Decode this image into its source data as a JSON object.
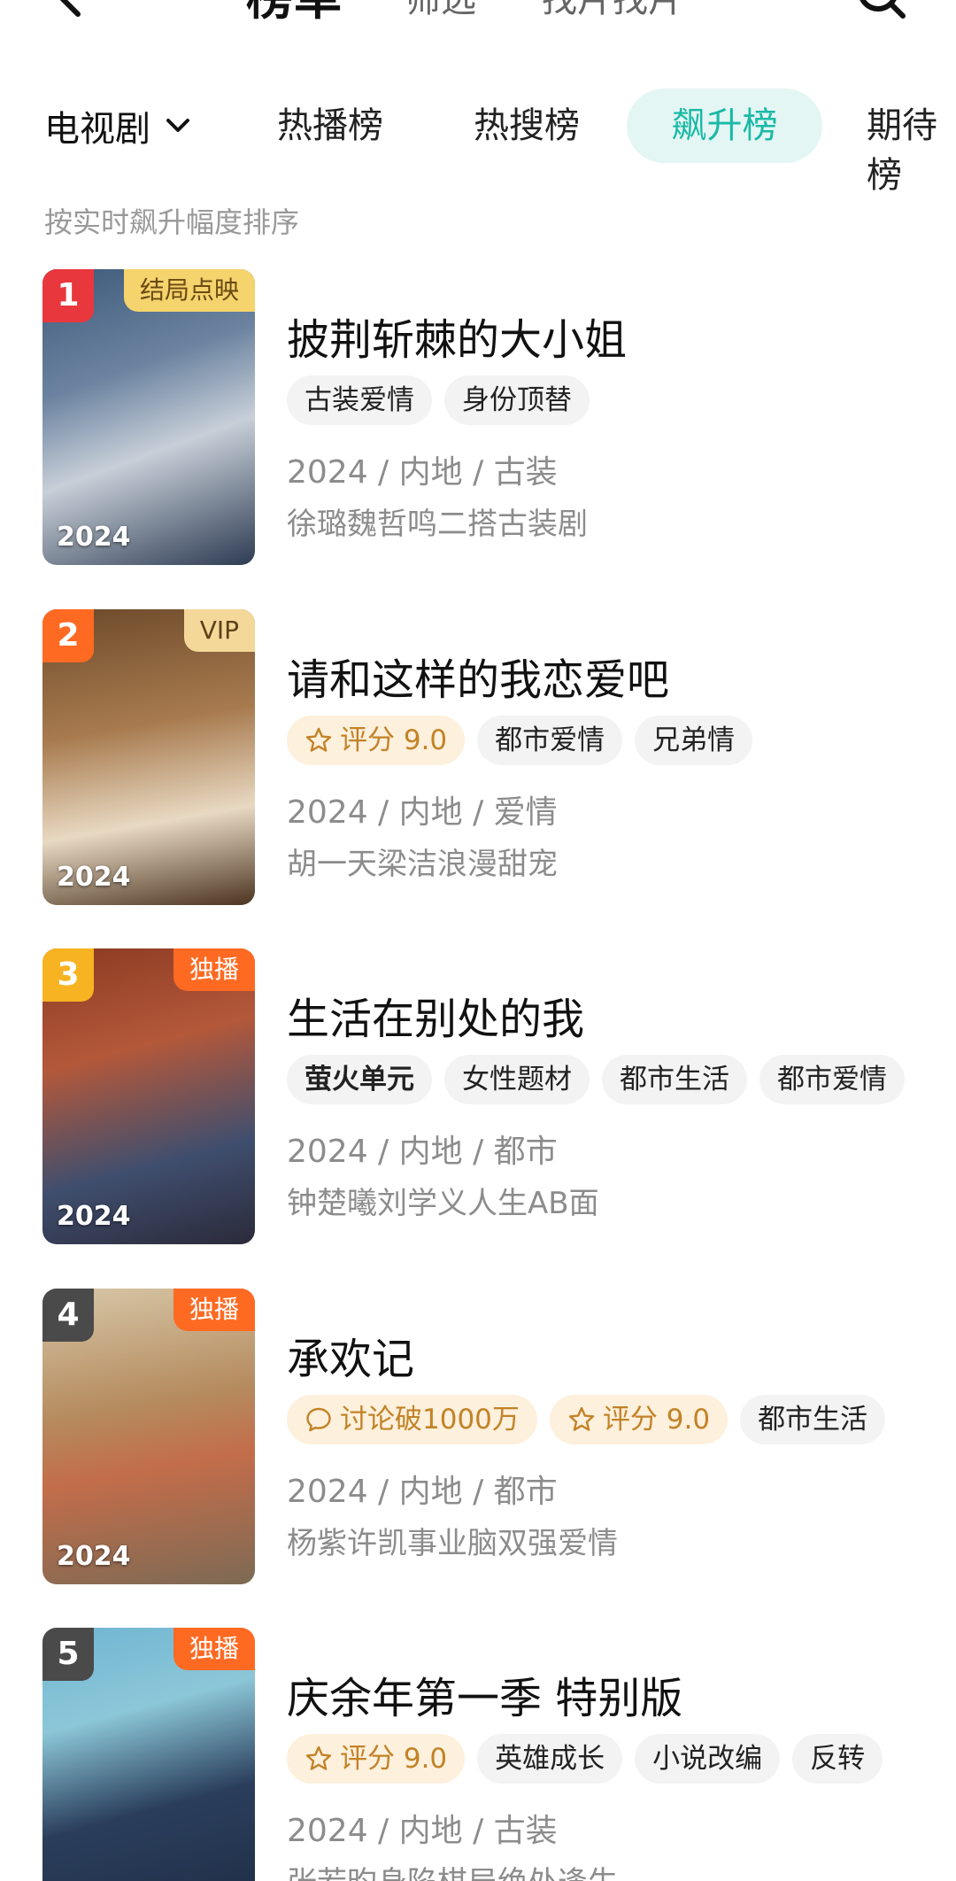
{
  "top_nav": {
    "title": "榜单",
    "tabs": [
      "筛选",
      "找片找片"
    ]
  },
  "categories": {
    "dropdown_label": "电视剧",
    "tabs": [
      "热播榜",
      "热搜榜",
      "飙升榜",
      "期待榜"
    ],
    "selected": "飙升榜"
  },
  "subtitle": "按实时飙升幅度排序",
  "colors": {
    "accent": "#19b9a6",
    "accent_bg": "#e3f6f4",
    "rank_red": "#e8383d",
    "rank_orange": "#ff6a23",
    "rank_yellow": "#f7b321",
    "rank_gray": "#4a4a4a"
  },
  "items": [
    {
      "rank": "1",
      "badge": "结局点映",
      "year_overlay": "2024",
      "title": "披荆斩棘的大小姐",
      "tags": [
        "古装爱情",
        "身份顶替"
      ],
      "meta": "2024 / 内地 / 古装",
      "desc": "徐璐魏哲鸣二搭古装剧"
    },
    {
      "rank": "2",
      "badge": "VIP",
      "year_overlay": "2024",
      "title": "请和这样的我恋爱吧",
      "score_tag": "评分 9.0",
      "tags": [
        "都市爱情",
        "兄弟情"
      ],
      "meta": "2024 / 内地 / 爱情",
      "desc": "胡一天梁洁浪漫甜宠"
    },
    {
      "rank": "3",
      "badge": "独播",
      "year_overlay": "2024",
      "title": "生活在别处的我",
      "brand_tag": "萤火单元",
      "tags": [
        "女性题材",
        "都市生活",
        "都市爱情"
      ],
      "meta": "2024 / 内地 / 都市",
      "desc": "钟楚曦刘学义人生AB面"
    },
    {
      "rank": "4",
      "badge": "独播",
      "year_overlay": "2024",
      "title": "承欢记",
      "discuss_tag": "讨论破1000万",
      "score_tag": "评分 9.0",
      "tags": [
        "都市生活"
      ],
      "meta": "2024 / 内地 / 都市",
      "desc": "杨紫许凯事业脑双强爱情"
    },
    {
      "rank": "5",
      "badge": "独播",
      "title": "庆余年第一季 特别版",
      "score_tag": "评分 9.0",
      "tags": [
        "英雄成长",
        "小说改编",
        "反转"
      ],
      "meta": "2024 / 内地 / 古装",
      "desc": "张若昀身陷棋局绝处逢生"
    }
  ]
}
